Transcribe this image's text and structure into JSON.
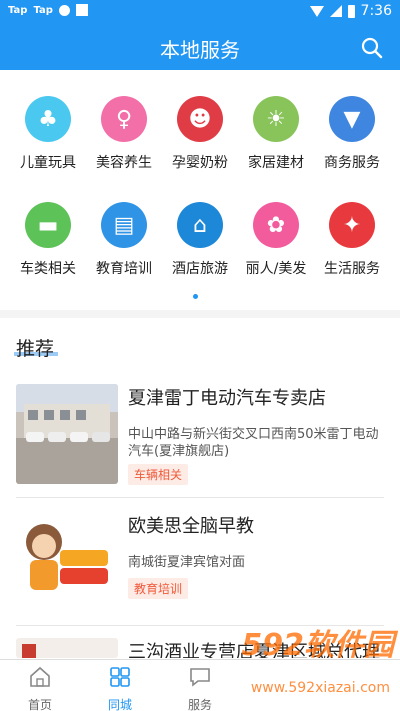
{
  "status_bar": {
    "left_labels": [
      "Tap",
      "Tap"
    ],
    "time": "7:36"
  },
  "app_bar": {
    "title": "本地服务"
  },
  "categories": [
    {
      "label": "儿童玩具",
      "icon": "teddy-bear-icon",
      "color": "#4bc8f0",
      "glyph": "♣"
    },
    {
      "label": "美容养生",
      "icon": "beauty-lady-icon",
      "color": "#f26fa8",
      "glyph": "♀"
    },
    {
      "label": "孕婴奶粉",
      "icon": "baby-bear-icon",
      "color": "#e03c46",
      "glyph": "☻"
    },
    {
      "label": "家居建材",
      "icon": "lightbulb-icon",
      "color": "#88c45a",
      "glyph": "☀"
    },
    {
      "label": "商务服务",
      "icon": "tie-icon",
      "color": "#3f86e0",
      "glyph": "▼"
    },
    {
      "label": "车类相关",
      "icon": "car-icon",
      "color": "#5dc257",
      "glyph": "▬"
    },
    {
      "label": "教育培训",
      "icon": "book-icon",
      "color": "#2f93e6",
      "glyph": "▤"
    },
    {
      "label": "酒店旅游",
      "icon": "house-icon",
      "color": "#1e88d8",
      "glyph": "⌂"
    },
    {
      "label": "丽人/美发",
      "icon": "hair-lady-icon",
      "color": "#f25c9d",
      "glyph": "✿"
    },
    {
      "label": "生活服务",
      "icon": "dove-icon",
      "color": "#e8393e",
      "glyph": "✦"
    }
  ],
  "recommend": {
    "title": "推荐",
    "items": [
      {
        "name": "夏津雷丁电动汽车专卖店",
        "address": "中山中路与新兴街交叉口西南50米雷丁电动汽车(夏津旗舰店)",
        "tag": "车辆相关"
      },
      {
        "name": "欧美思全脑早教",
        "address": "南城街夏津宾馆对面",
        "tag": "教育培训"
      },
      {
        "name": "三沟酒业专营店夏津区域总代理",
        "address": "",
        "tag": ""
      }
    ]
  },
  "bottom_nav": [
    {
      "label": "首页",
      "icon": "home-icon",
      "active": false
    },
    {
      "label": "同城",
      "icon": "grid-icon",
      "active": true
    },
    {
      "label": "服务",
      "icon": "message-icon",
      "active": false
    }
  ],
  "watermark": {
    "logo": "592软件园",
    "url": "www.592xiazai.com"
  },
  "colors": {
    "primary": "#2196f3",
    "tag_text": "#f05a3a",
    "tag_bg": "#fdebe6"
  }
}
